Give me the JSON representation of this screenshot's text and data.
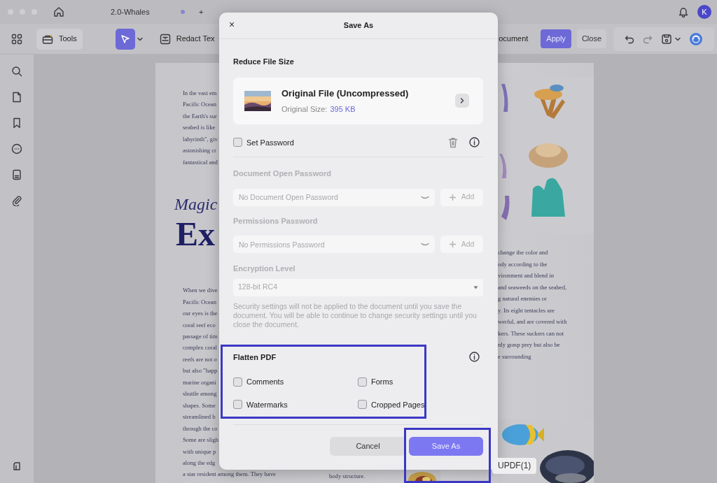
{
  "titlebar": {
    "tabs": [
      {
        "label": "2.0-Whales",
        "selected": true
      }
    ],
    "new_tab": "+",
    "avatar": "K"
  },
  "toolbar": {
    "tools": "Tools",
    "select_tool_active": true,
    "redact": "Redact Tex",
    "document": "ocument",
    "apply": "Apply",
    "close": "Close"
  },
  "page": {
    "left_lines_1": [
      "In the vast em",
      "Pacific Ocean",
      "the Earth's sur",
      "seabed is like",
      "labyrinth\", giv",
      "astonishing cr",
      "fantastical and"
    ],
    "heading_1": "Magic",
    "heading_2": "Ex",
    "left_lines_2": [
      "When we dive",
      "Pacific Ocean",
      "our eyes is the",
      "coral reef eco",
      "passage of tim",
      "complex coral",
      "reefs are not o",
      "but also \"happ",
      "marine organi",
      "shuttle among",
      "shapes. Some",
      "streamlined b",
      "through the co",
      "Some are sligh",
      "with unique p",
      "along the edg",
      "a star resident among them. They have"
    ],
    "right_lines": [
      "change the color and",
      "ody according to the",
      "vironment and blend in",
      "and seaweeds on the seabed,",
      "g natural enemies or",
      "y. Its eight tentacles are",
      "werful, and are covered with",
      "kers. These suckers can not",
      "nly grasp prey but also be",
      "e surrounding"
    ],
    "bottom_line": "body structure."
  },
  "dialog": {
    "title": "Save As",
    "close": "×",
    "reduce_title": "Reduce File Size",
    "file": {
      "name": "Original File (Uncompressed)",
      "size_label": "Original Size:",
      "size_value": "395 KB"
    },
    "set_password": {
      "label": "Set Password",
      "checked": false
    },
    "passwords": [
      {
        "label": "Document Open Password",
        "placeholder": "No Document Open Password",
        "add": "Add",
        "disabled": true
      },
      {
        "label": "Permissions Password",
        "placeholder": "No Permissions Password",
        "add": "Add",
        "disabled": true
      }
    ],
    "encryption": {
      "label": "Encryption Level",
      "value": "128-bit RC4",
      "disabled": true
    },
    "note": "Security settings will not be applied to the document until you save the document. You will be able to continue to change security settings until you close the document.",
    "flatten": {
      "title": "Flatten PDF",
      "highlighted": true,
      "options": [
        {
          "label": "Comments",
          "checked": false
        },
        {
          "label": "Forms",
          "checked": false
        },
        {
          "label": "Watermarks",
          "checked": false
        },
        {
          "label": "Cropped Pages",
          "checked": false
        }
      ]
    },
    "cancel": "Cancel",
    "save": {
      "label": "Save As",
      "highlighted": true
    }
  },
  "tooltip": "UPDF(1)"
}
